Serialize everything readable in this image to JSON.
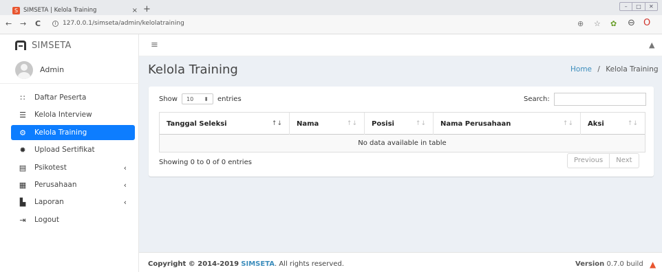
{
  "browser": {
    "tab_title": "SIMSETA | Kelola Training",
    "tab_close": "×",
    "new_tab": "+",
    "url": "127.0.0.1/simseta/admin/kelolatraining",
    "favicon": "S",
    "win_controls": [
      "–",
      "□",
      "✕"
    ],
    "nav": {
      "back": "←",
      "forward": "→",
      "reload": "C"
    }
  },
  "app": {
    "brand": "SIMSETA",
    "brand_color": "#333333"
  },
  "sidebar": {
    "user": "Admin",
    "items": [
      {
        "label": "Daftar Peserta",
        "icon": "users-icon",
        "glyph": "👥",
        "active": false,
        "chevron": false
      },
      {
        "label": "Kelola Interview",
        "icon": "list-icon",
        "glyph": "☰",
        "active": false,
        "chevron": false
      },
      {
        "label": "Kelola Training",
        "icon": "cogs-icon",
        "glyph": "⚙",
        "active": true,
        "chevron": false
      },
      {
        "label": "Upload Sertifikat",
        "icon": "certificate-icon",
        "glyph": "✹",
        "active": false,
        "chevron": false
      },
      {
        "label": "Psikotest",
        "icon": "notebook-icon",
        "glyph": "▤",
        "active": false,
        "chevron": true
      },
      {
        "label": "Perusahaan",
        "icon": "building-icon",
        "glyph": "▦",
        "active": false,
        "chevron": true
      },
      {
        "label": "Laporan",
        "icon": "file-icon",
        "glyph": "▙",
        "active": false,
        "chevron": true
      },
      {
        "label": "Logout",
        "icon": "sign-out-icon",
        "glyph": "⇥",
        "active": false,
        "chevron": false
      }
    ],
    "chevron_glyph": "‹",
    "active_color": "#0d7dff"
  },
  "content": {
    "title": "Kelola Training",
    "breadcrumb": {
      "home": "Home",
      "separator": "/",
      "current": "Kelola Training"
    },
    "table_controls": {
      "show_prefix": "Show",
      "show_value": "10",
      "show_suffix": "entries",
      "search_label": "Search:",
      "search_value": ""
    },
    "columns": [
      {
        "label": "Tanggal Seleksi",
        "sort_active": true
      },
      {
        "label": "Nama",
        "sort_active": false
      },
      {
        "label": "Posisi",
        "sort_active": false
      },
      {
        "label": "Nama Perusahaan",
        "sort_active": false
      },
      {
        "label": "Aksi",
        "sort_active": false
      }
    ],
    "empty_message": "No data available in table",
    "info": "Showing 0 to 0 of 0 entries",
    "pager": {
      "previous": "Previous",
      "next": "Next"
    }
  },
  "footer": {
    "copyright_prefix": "Copyright © 2014-2019",
    "copyright_brand": "SIMSETA",
    "copyright_suffix": ". All rights reserved.",
    "version_label": "Version",
    "version_value": "0.7.0 build"
  }
}
